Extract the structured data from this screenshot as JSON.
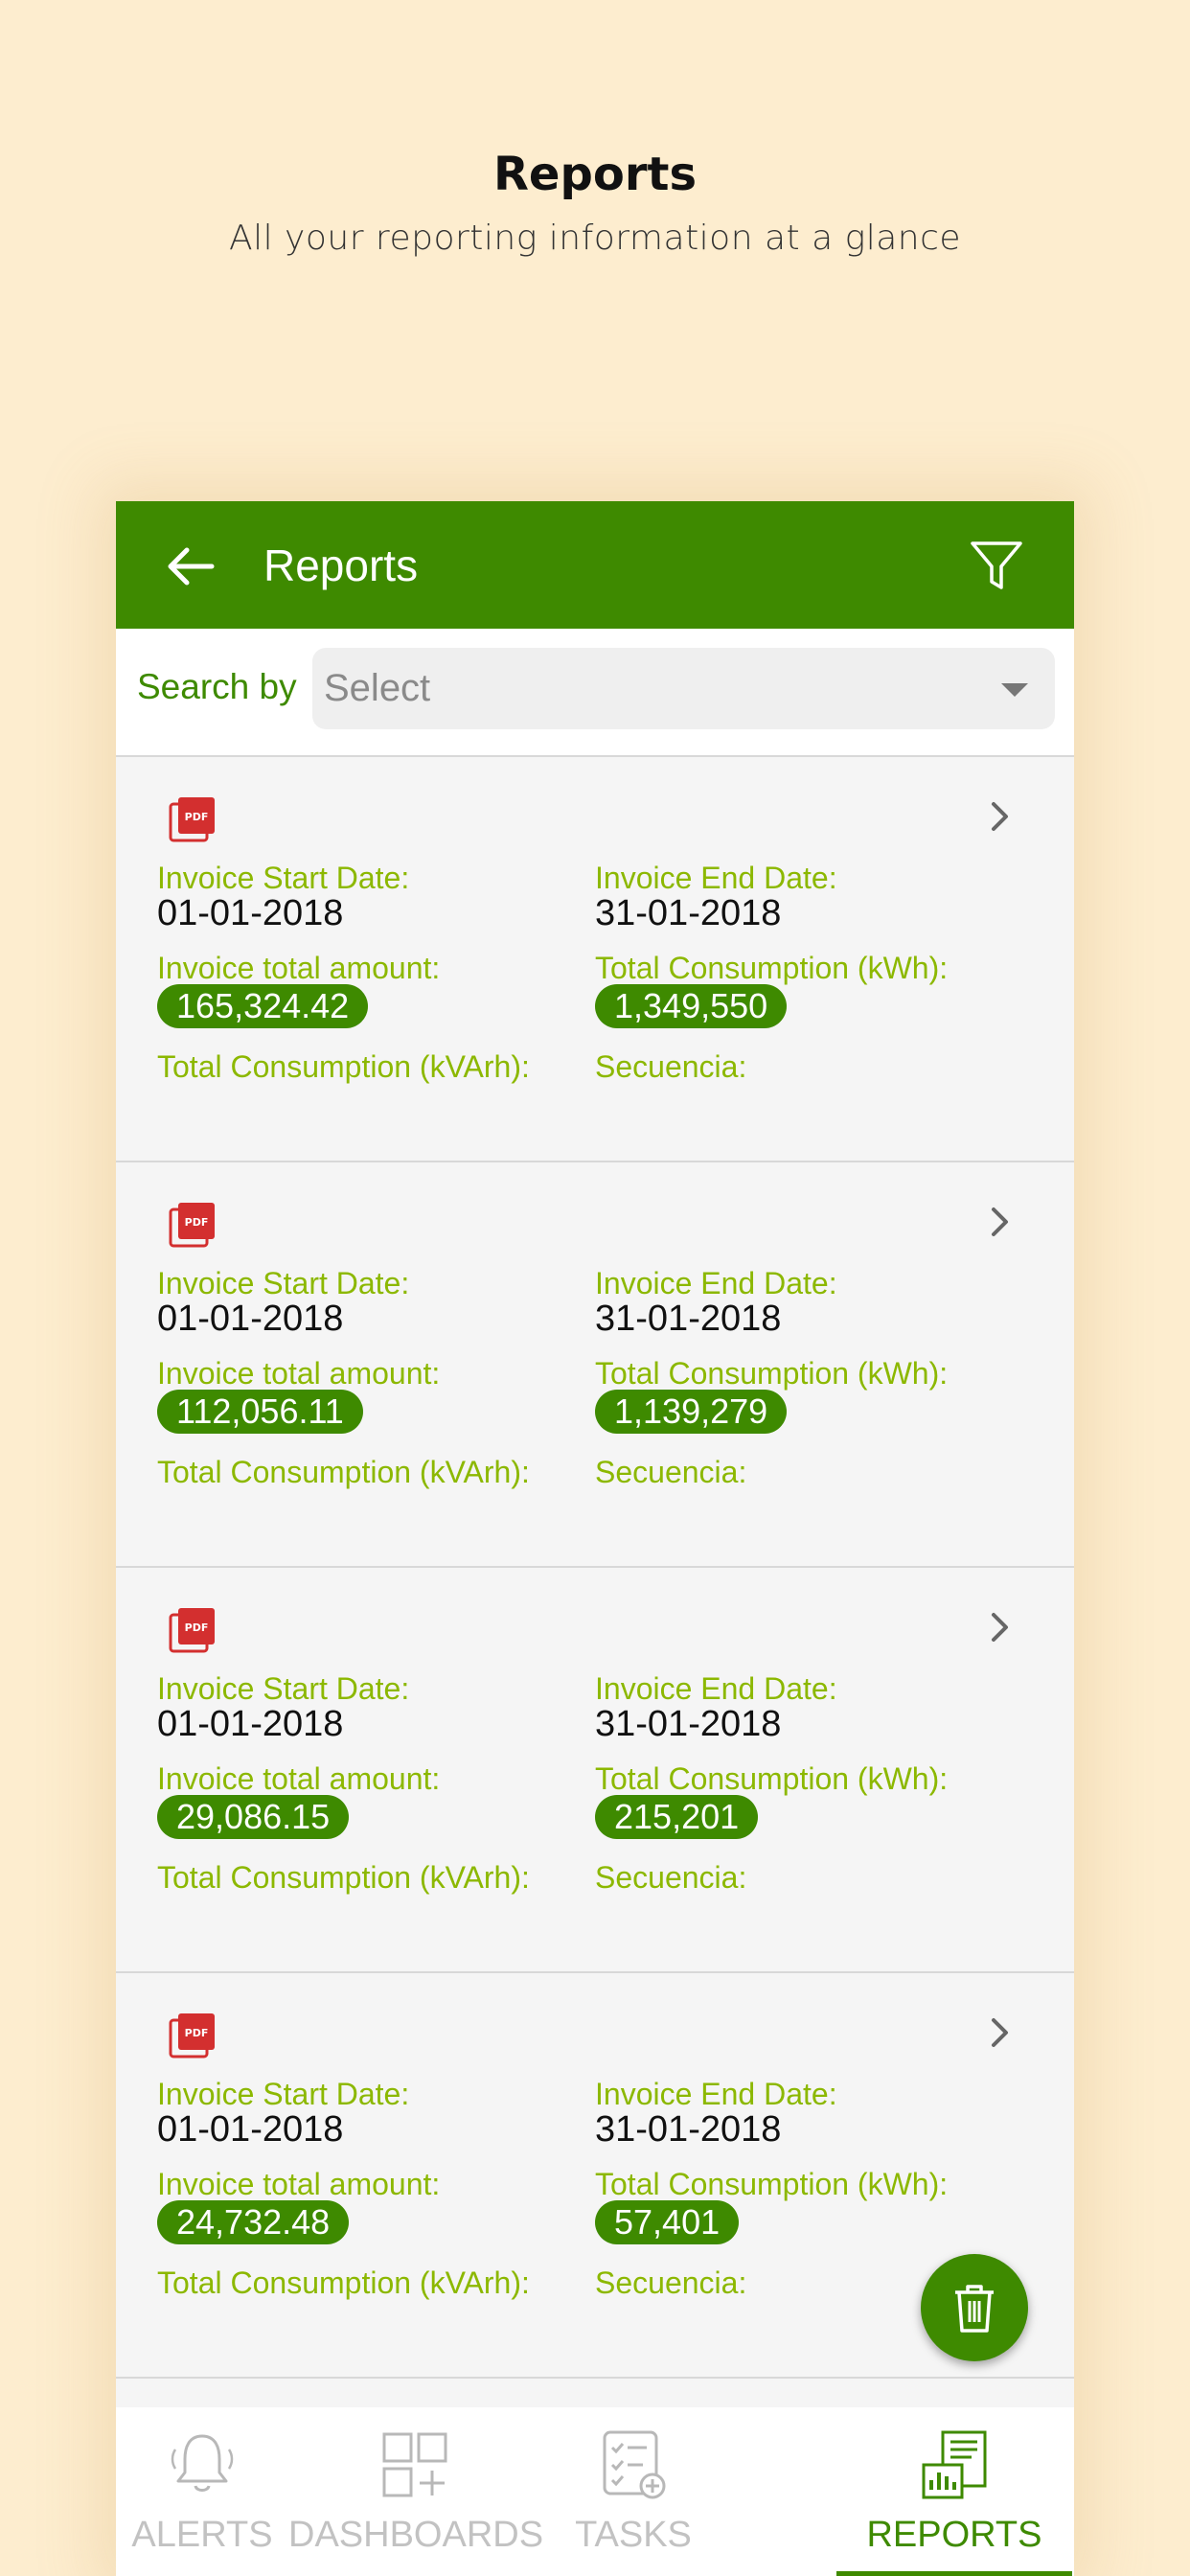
{
  "promo": {
    "title": "Reports",
    "subtitle": "All your reporting information at a glance"
  },
  "appbar": {
    "title": "Reports",
    "back_icon": "arrow-left-icon",
    "filter_icon": "filter-icon"
  },
  "search": {
    "label": "Search by",
    "selected": "Select"
  },
  "labels": {
    "start": "Invoice Start Date:",
    "end": "Invoice End Date:",
    "amount": "Invoice total amount:",
    "kwh": "Total Consumption (kWh):",
    "kvarh": "Total Consumption (kVArh):",
    "secuencia": "Secuencia:"
  },
  "reports": [
    {
      "start_date": "01-01-2018",
      "end_date": "31-01-2018",
      "amount": "165,324.42",
      "kwh": "1,349,550"
    },
    {
      "start_date": "01-01-2018",
      "end_date": "31-01-2018",
      "amount": "112,056.11",
      "kwh": "1,139,279"
    },
    {
      "start_date": "01-01-2018",
      "end_date": "31-01-2018",
      "amount": "29,086.15",
      "kwh": "215,201"
    },
    {
      "start_date": "01-01-2018",
      "end_date": "31-01-2018",
      "amount": "24,732.48",
      "kwh": "57,401"
    }
  ],
  "nav": {
    "alerts": "ALERTS",
    "dashboards": "DASHBOARDS",
    "tasks": "TASKS",
    "reports": "REPORTS",
    "active": "reports"
  },
  "colors": {
    "brand_green": "#3e8a00",
    "label_green": "#8cb800",
    "background": "#fdedcf",
    "pdf_red": "#d32f2f"
  }
}
